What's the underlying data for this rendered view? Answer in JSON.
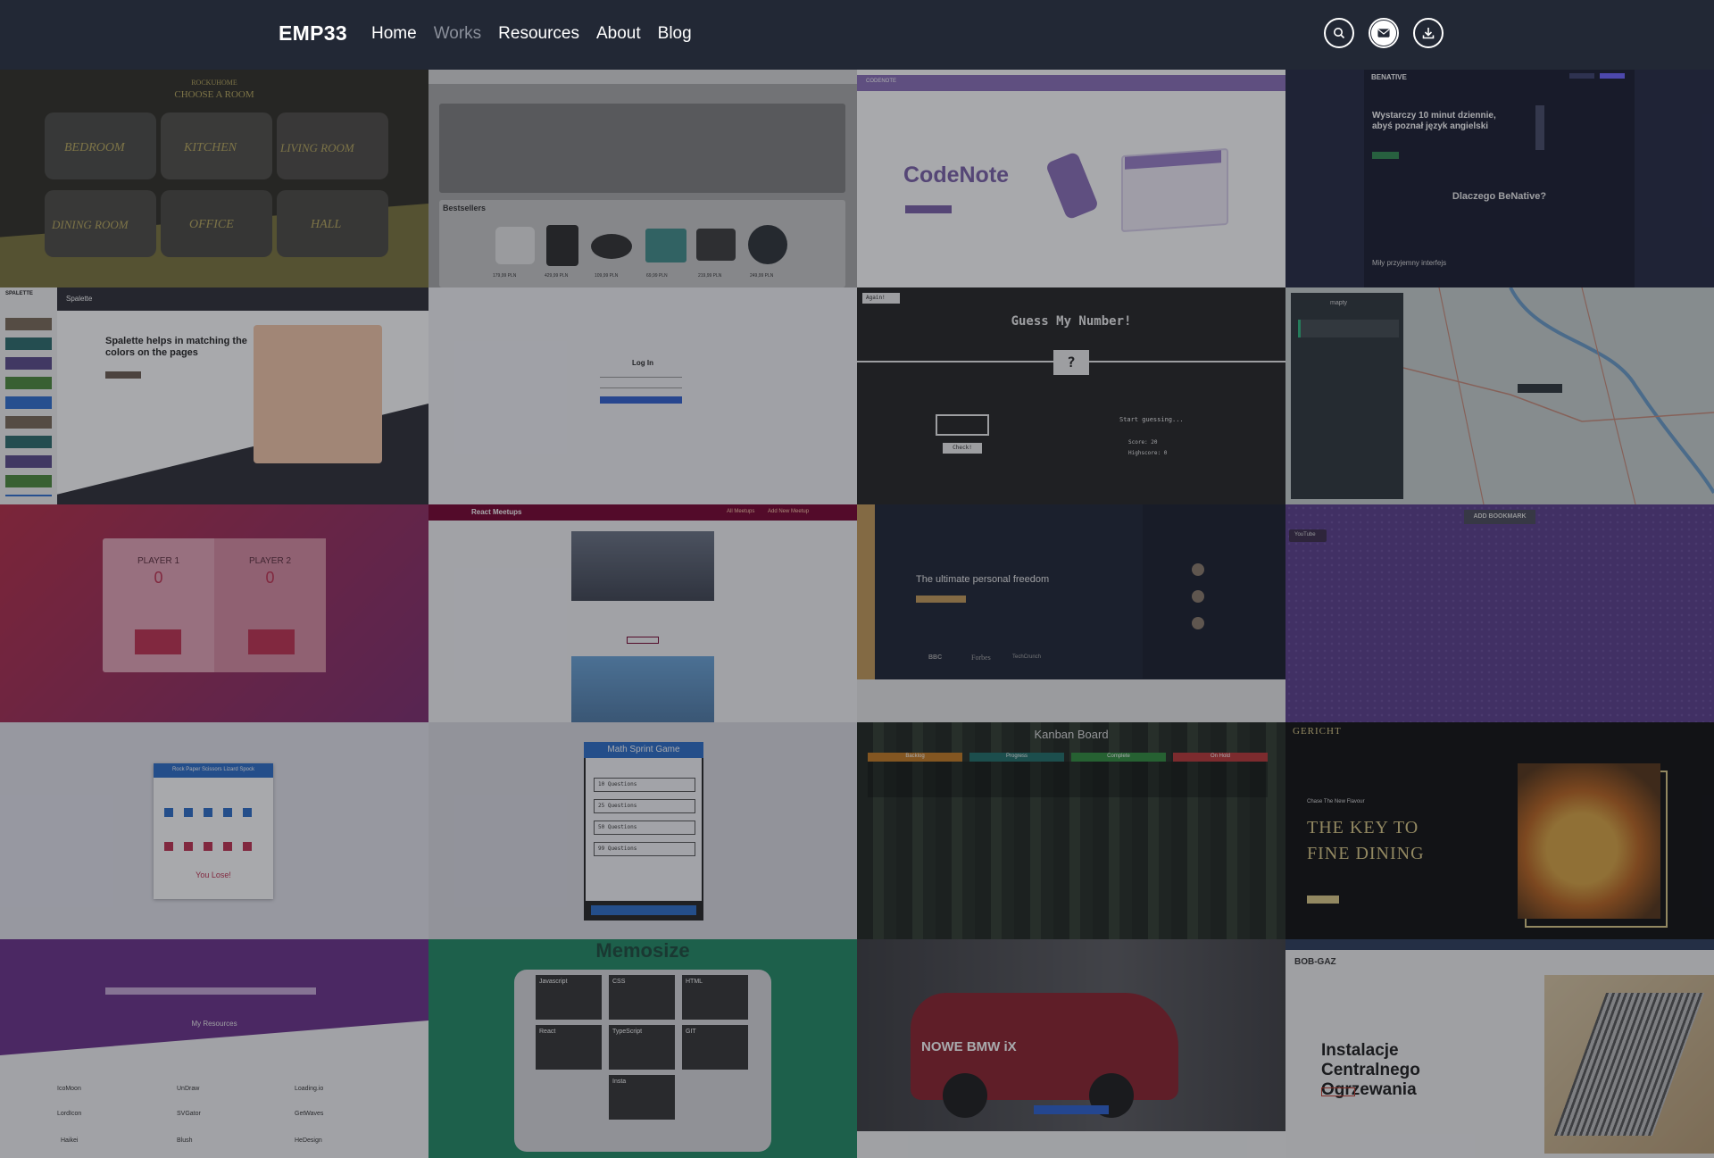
{
  "header": {
    "logo": "EMP33",
    "nav": [
      "Home",
      "Works",
      "Resources",
      "About",
      "Blog"
    ],
    "active_nav": "Works",
    "icons": [
      "search-icon",
      "mail-icon",
      "download-icon"
    ]
  },
  "tiles": {
    "rockuhome": {
      "brand": "ROCKUHOME",
      "title": "CHOOSE A ROOM",
      "rooms": [
        "BEDROOM",
        "KITCHEN",
        "LIVING ROOM",
        "DINING ROOM",
        "OFFICE",
        "HALL"
      ]
    },
    "shop": {
      "section": "Bestsellers",
      "prices": [
        "179,99 PLN",
        "429,99 PLN",
        "109,99 PLN",
        "69,99 PLN",
        "219,99 PLN",
        "249,99 PLN"
      ]
    },
    "codenote": {
      "brand": "CODENOTE",
      "title": "CodeNote"
    },
    "benative": {
      "brand": "BENATIVE",
      "headline": "Wystarczy 10 minut dziennie, abyś poznał język angielski",
      "question": "Dlaczego BeNative?",
      "feature": "Miły przyjemny interfejs"
    },
    "spalette": {
      "brand": "SPALETTE",
      "nav_title": "Spalette",
      "headline": "Spalette helps in matching the colors on the pages"
    },
    "login": {
      "title": "Log In"
    },
    "guess": {
      "title": "Guess My Number!",
      "mark": "?",
      "again": "Again!",
      "check": "Check!",
      "status": "Start guessing...",
      "score": "Score: 20",
      "highscore": "Highscore: 0"
    },
    "mapty": {
      "brand": "mapty"
    },
    "pig": {
      "p1": "PLAYER 1",
      "p2": "PLAYER 2",
      "s1": "0",
      "s2": "0"
    },
    "meetups": {
      "brand": "React Meetups",
      "nav1": "All Meetups",
      "nav2": "Add New Meetup"
    },
    "freedom": {
      "headline": "The ultimate personal freedom",
      "logos": [
        "BBC",
        "Forbes",
        "TechCrunch"
      ]
    },
    "bookmark": {
      "button": "ADD BOOKMARK",
      "chip": "YouTube"
    },
    "rps": {
      "title": "Rock Paper Scissors Lizard Spock",
      "result": "You Lose!"
    },
    "math": {
      "title": "Math Sprint Game",
      "options": [
        "10 Questions",
        "25 Questions",
        "50 Questions",
        "99 Questions"
      ]
    },
    "kanban": {
      "title": "Kanban Board",
      "columns": [
        "Backlog",
        "Progress",
        "Complete",
        "On Hold"
      ]
    },
    "gericht": {
      "brand": "GERICHT",
      "sub": "Chase The New Flavour",
      "headline": "THE KEY TO FINE DINING"
    },
    "resources": {
      "title": "My Resources",
      "items": [
        "IcoMoon",
        "UnDraw",
        "Loading.io",
        "LordIcon",
        "SVGator",
        "GetWaves",
        "Haikei",
        "Blush",
        "HeDesign"
      ]
    },
    "memosize": {
      "title": "Memosize",
      "cards": [
        "Javascript",
        "CSS",
        "HTML",
        "React",
        "TypeScript",
        "GIT",
        "Insta"
      ]
    },
    "bmw": {
      "headline": "NOWE BMW iX"
    },
    "bobgaz": {
      "brand": "BOB-GAZ",
      "headline": "Instalacje Centralnego Ogrzewania"
    }
  },
  "colors": {
    "header_bg": "#222835",
    "codenote_purple": "#7a5fa8",
    "pig_red": "#c0304f",
    "bookmark_purple": "#5a3d8c",
    "memosize_green": "#1f8a63",
    "math_blue": "#2a6cc9",
    "kanban_backlog": "#c47a1f",
    "kanban_progress": "#1d6c66",
    "kanban_complete": "#2e8b3a",
    "kanban_hold": "#b93535"
  }
}
